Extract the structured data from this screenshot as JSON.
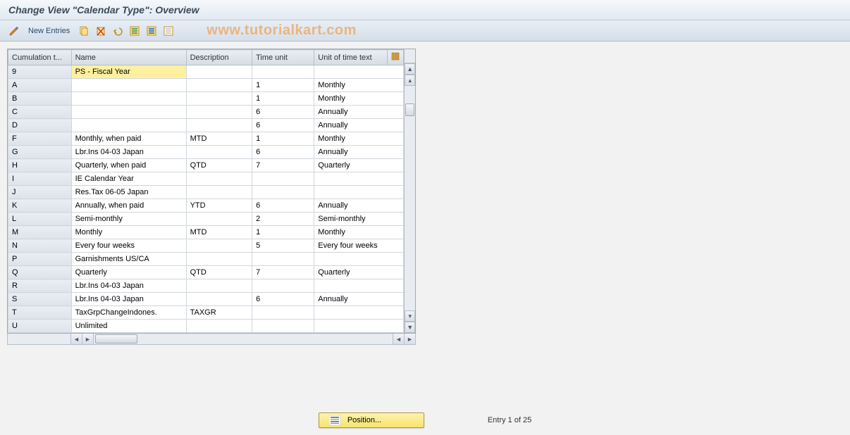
{
  "title": "Change View \"Calendar Type\": Overview",
  "toolbar": {
    "new_entries": "New Entries",
    "watermark": "www.tutorialkart.com"
  },
  "columns": {
    "cumulation": "Cumulation t...",
    "name": "Name",
    "description": "Description",
    "time_unit": "Time unit",
    "unit_text": "Unit of time text"
  },
  "rows": [
    {
      "ct": "9",
      "name": "PS - Fiscal Year",
      "desc": "",
      "tu": "",
      "ut": "",
      "hl": true
    },
    {
      "ct": "A",
      "name": "",
      "desc": "",
      "tu": "1",
      "ut": "Monthly"
    },
    {
      "ct": "B",
      "name": "",
      "desc": "",
      "tu": "1",
      "ut": "Monthly"
    },
    {
      "ct": "C",
      "name": "",
      "desc": "",
      "tu": "6",
      "ut": "Annually"
    },
    {
      "ct": "D",
      "name": "",
      "desc": "",
      "tu": "6",
      "ut": "Annually"
    },
    {
      "ct": "F",
      "name": "Monthly, when paid",
      "desc": "MTD",
      "tu": "1",
      "ut": "Monthly"
    },
    {
      "ct": "G",
      "name": "Lbr.Ins 04-03  Japan",
      "desc": "",
      "tu": "6",
      "ut": "Annually"
    },
    {
      "ct": "H",
      "name": "Quarterly, when paid",
      "desc": "QTD",
      "tu": "7",
      "ut": "Quarterly"
    },
    {
      "ct": "I",
      "name": "IE Calendar Year",
      "desc": "",
      "tu": "",
      "ut": ""
    },
    {
      "ct": "J",
      "name": "Res.Tax 06-05  Japan",
      "desc": "",
      "tu": "",
      "ut": ""
    },
    {
      "ct": "K",
      "name": "Annually, when paid",
      "desc": "YTD",
      "tu": "6",
      "ut": "Annually"
    },
    {
      "ct": "L",
      "name": "Semi-monthly",
      "desc": "",
      "tu": "2",
      "ut": "Semi-monthly"
    },
    {
      "ct": "M",
      "name": "Monthly",
      "desc": "MTD",
      "tu": "1",
      "ut": "Monthly"
    },
    {
      "ct": "N",
      "name": "Every four weeks",
      "desc": "",
      "tu": "5",
      "ut": "Every four weeks"
    },
    {
      "ct": "P",
      "name": "Garnishments US/CA",
      "desc": "",
      "tu": "",
      "ut": ""
    },
    {
      "ct": "Q",
      "name": "Quarterly",
      "desc": "QTD",
      "tu": "7",
      "ut": "Quarterly"
    },
    {
      "ct": "R",
      "name": "Lbr.Ins 04-03  Japan",
      "desc": "",
      "tu": "",
      "ut": ""
    },
    {
      "ct": "S",
      "name": "Lbr.Ins 04-03  Japan",
      "desc": "",
      "tu": "6",
      "ut": "Annually"
    },
    {
      "ct": "T",
      "name": "TaxGrpChangeIndones.",
      "desc": "TAXGR",
      "tu": "",
      "ut": ""
    },
    {
      "ct": "U",
      "name": "Unlimited",
      "desc": "",
      "tu": "",
      "ut": ""
    }
  ],
  "footer": {
    "position_label": "Position...",
    "entry_text": "Entry 1 of 25"
  }
}
